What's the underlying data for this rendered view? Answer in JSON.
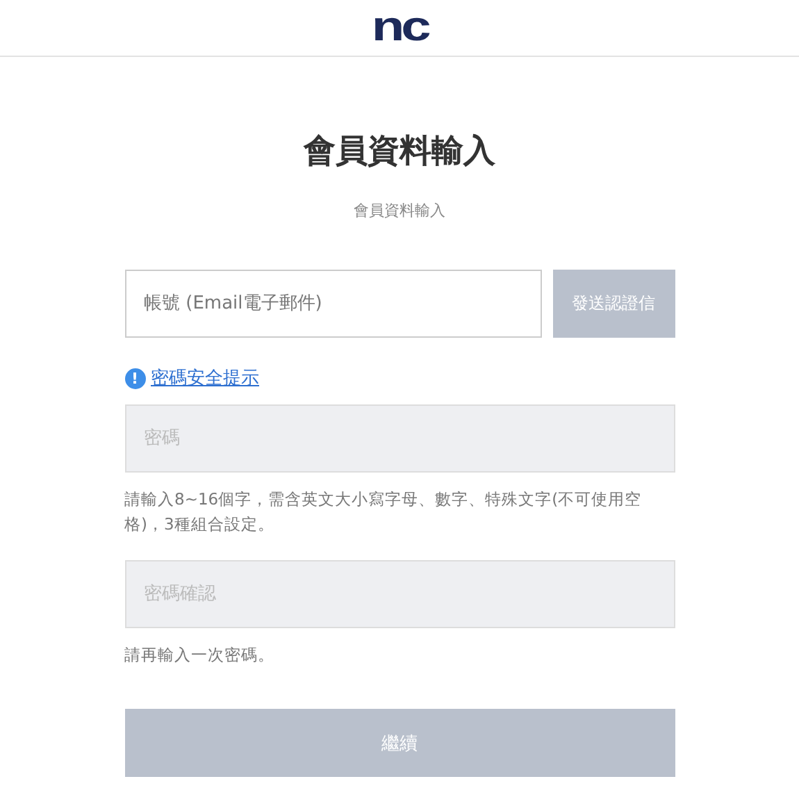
{
  "header": {
    "logo": "nc"
  },
  "title": "會員資料輸入",
  "subtitle": "會員資料輸入",
  "account": {
    "placeholder": "帳號 (Email電子郵件)",
    "disabled": false
  },
  "send_button": {
    "label": "發送認證信",
    "disabled": true
  },
  "password_tip": {
    "icon": "!",
    "label": "密碼安全提示"
  },
  "password": {
    "placeholder": "密碼",
    "disabled": true
  },
  "password_help": "請輸入8~16個字，需含英文大小寫字母、數字、特殊文字(不可使用空格)，3種組合設定。",
  "confirm": {
    "placeholder": "密碼確認",
    "disabled": true
  },
  "confirm_help": "請再輸入一次密碼。",
  "continue_button": {
    "label": "繼續",
    "disabled": true
  }
}
